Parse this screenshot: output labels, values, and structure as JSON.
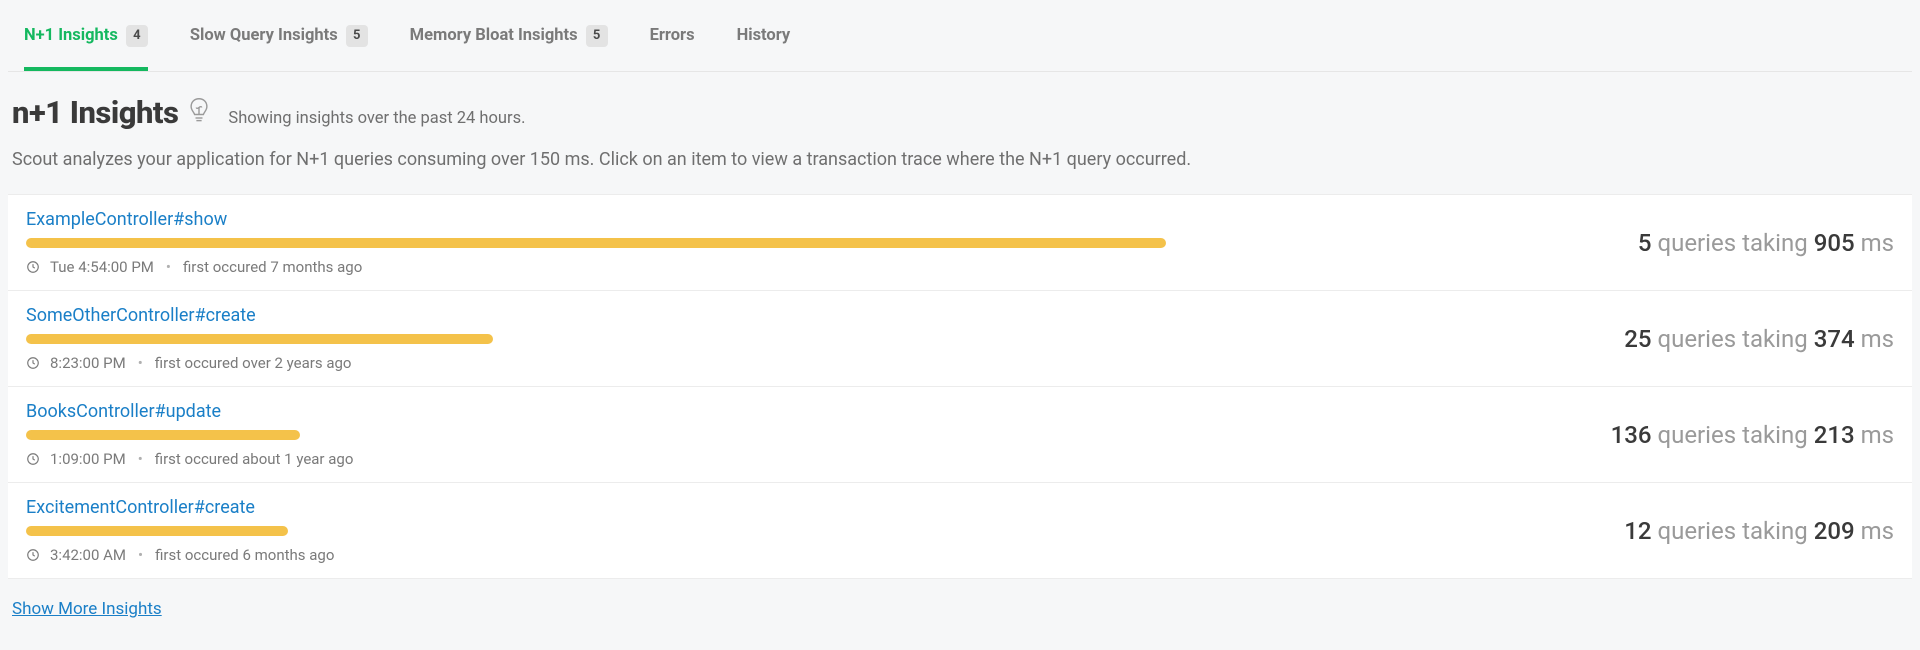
{
  "tabs": [
    {
      "label": "N+1 Insights",
      "count": "4",
      "active": true
    },
    {
      "label": "Slow Query Insights",
      "count": "5",
      "active": false
    },
    {
      "label": "Memory Bloat Insights",
      "count": "5",
      "active": false
    },
    {
      "label": "Errors",
      "count": null,
      "active": false
    },
    {
      "label": "History",
      "count": null,
      "active": false
    }
  ],
  "header": {
    "title": "n+1 Insights",
    "subtitle": "Showing insights over the past 24 hours.",
    "description": "Scout analyzes your application for N+1 queries consuming over 150 ms. Click on an item to view a transaction trace where the N+1 query occurred."
  },
  "insights": [
    {
      "name": "ExampleController#show",
      "bar_pct": 100,
      "time": "Tue 4:54:00 PM",
      "first": "first occured 7 months ago",
      "queries": "5",
      "ms": "905"
    },
    {
      "name": "SomeOtherController#create",
      "bar_pct": 41,
      "time": "8:23:00 PM",
      "first": "first occured over 2 years ago",
      "queries": "25",
      "ms": "374"
    },
    {
      "name": "BooksController#update",
      "bar_pct": 24,
      "time": "1:09:00 PM",
      "first": "first occured about 1 year ago",
      "queries": "136",
      "ms": "213"
    },
    {
      "name": "ExcitementController#create",
      "bar_pct": 23,
      "time": "3:42:00 AM",
      "first": "first occured 6 months ago",
      "queries": "12",
      "ms": "209"
    }
  ],
  "labels": {
    "queries_taking": "queries taking",
    "ms": "ms"
  },
  "show_more": "Show More Insights"
}
